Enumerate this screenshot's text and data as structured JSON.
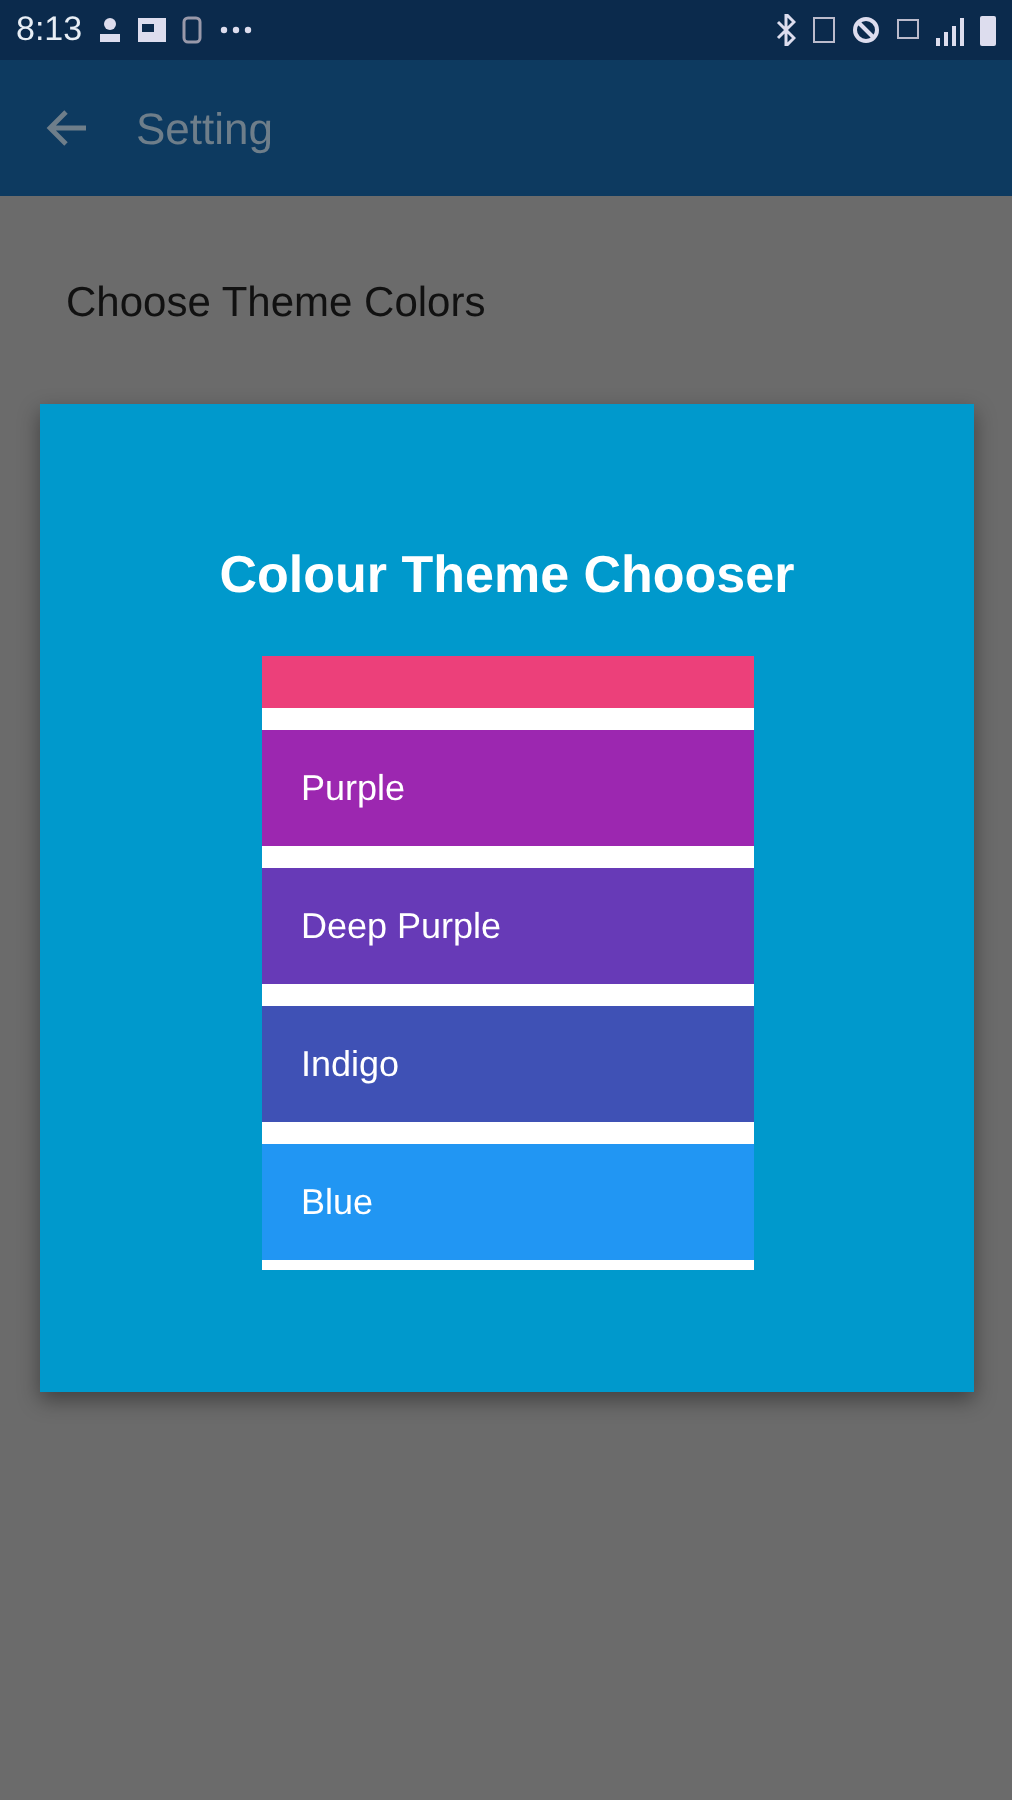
{
  "status_bar": {
    "time": "8:13"
  },
  "app_bar": {
    "title": "Setting"
  },
  "page": {
    "heading": "Choose Theme Colors"
  },
  "dialog": {
    "title": "Colour Theme Chooser",
    "themes": [
      {
        "color": "#ec407a"
      },
      {
        "label": "Purple",
        "color": "#9c27b0"
      },
      {
        "label": "Deep Purple",
        "color": "#673ab7"
      },
      {
        "label": "Indigo",
        "color": "#3f51b5"
      },
      {
        "label": "Blue",
        "color": "#2196f3"
      }
    ]
  }
}
